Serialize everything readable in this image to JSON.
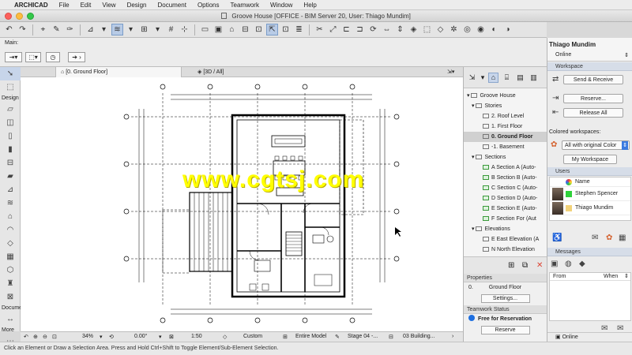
{
  "menubar": {
    "app_name": "ARCHICAD",
    "items": [
      "File",
      "Edit",
      "View",
      "Design",
      "Document",
      "Options",
      "Teamwork",
      "Window",
      "Help"
    ]
  },
  "window": {
    "title": "Groove House [OFFICE - BIM Server 20, User: Thiago Mundim]"
  },
  "infobox": {
    "label": "Main:"
  },
  "toolbox": {
    "design_label": "Design",
    "document_label": "Docume",
    "more_label": "More"
  },
  "tabs": [
    {
      "label": "[0. Ground Floor]",
      "active": true
    },
    {
      "label": "[3D / All]",
      "active": false
    }
  ],
  "canvas": {
    "watermark": "www.cgtsj.com"
  },
  "navigator": {
    "project": "Groove House",
    "stories_label": "Stories",
    "stories": [
      {
        "label": "2. Roof Level",
        "selected": false
      },
      {
        "label": "1. First Floor",
        "selected": false
      },
      {
        "label": "0. Ground Floor",
        "selected": true
      },
      {
        "label": "-1. Basement",
        "selected": false
      }
    ],
    "sections_label": "Sections",
    "sections": [
      "A Section A (Auto-",
      "B Section B (Auto-",
      "C Section C (Auto-",
      "D Section D (Auto-",
      "E Section E (Auto-",
      "F Section For (Aut"
    ],
    "elevations_label": "Elevations",
    "elevations": [
      "E East Elevation (A",
      "N North Elevation"
    ]
  },
  "properties": {
    "header": "Properties",
    "story_number": "0.",
    "story_name": "Ground Floor",
    "settings_button": "Settings..."
  },
  "teamwork_status": {
    "header": "Teamwork Status",
    "status": "Free for Reservation",
    "reserve_button": "Reserve"
  },
  "teamwork": {
    "user_name": "Thiago Mundim",
    "user_status": "Online",
    "workspace_header": "Workspace",
    "send_receive": "Send & Receive",
    "reserve": "Reserve...",
    "release_all": "Release All",
    "colored_workspaces_label": "Colored workspaces:",
    "colored_workspaces_value": "All with original Color",
    "my_workspace": "My Workspace",
    "users_header": "Users",
    "name_column": "Name",
    "users": [
      {
        "name": "Stephen Spencer",
        "color": "#2fd13a"
      },
      {
        "name": "Thiago Mundim",
        "color": "#f2d27a"
      }
    ],
    "messages_header": "Messages",
    "from_label": "From",
    "when_label": "When",
    "bottom_status": "Online"
  },
  "zoombar": {
    "zoom": "34%",
    "angle": "0.00°",
    "scale": "1:50",
    "layer_combo": "Custom",
    "model_view": "Entire Model",
    "pen_set": "Stage 04 -...",
    "dimension": "03 Building..."
  },
  "hint": {
    "text": "Click an Element or Draw a Selection Area. Press and Hold Ctrl+Shift to Toggle Element/Sub-Element Selection."
  },
  "colors": {
    "selection": "#c7d5ea",
    "watermark": "#ffff00",
    "panel_header": "#d6dde8"
  }
}
